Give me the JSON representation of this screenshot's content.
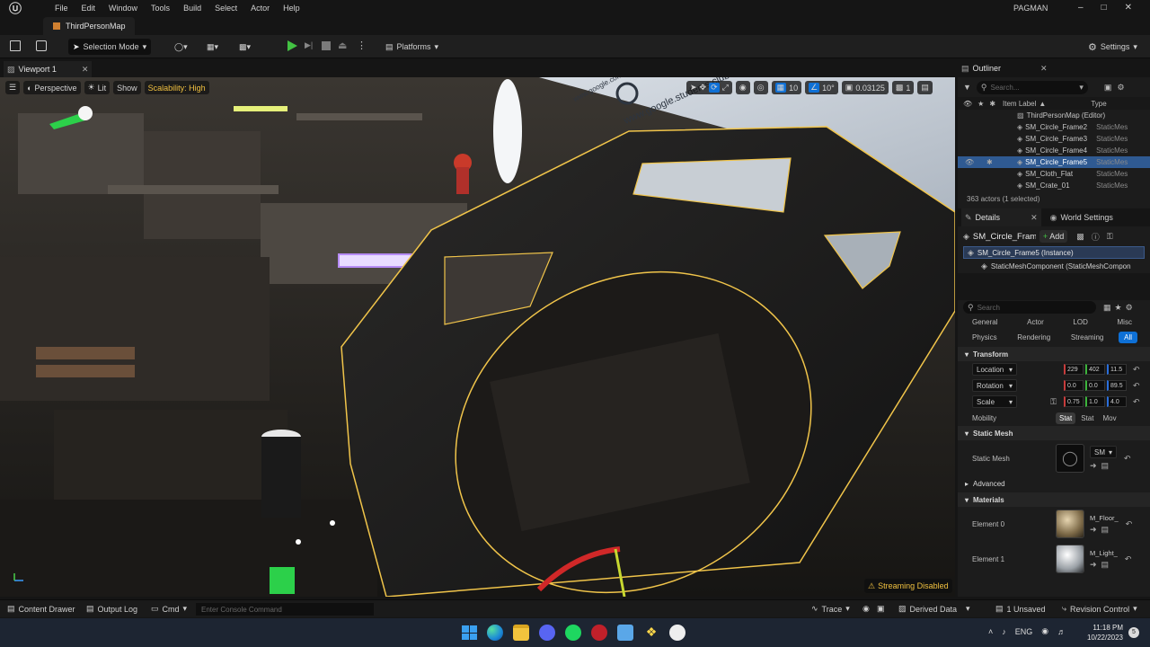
{
  "app": {
    "project_name": "PAGMAN",
    "map_tab": "ThirdPersonMap"
  },
  "menu": [
    "File",
    "Edit",
    "Window",
    "Tools",
    "Build",
    "Select",
    "Actor",
    "Help"
  ],
  "toolbar": {
    "selection_mode": "Selection Mode",
    "platforms": "Platforms",
    "settings": "Settings"
  },
  "viewport": {
    "tab": "Viewport 1",
    "perspective": "Perspective",
    "lit": "Lit",
    "show": "Show",
    "scalability": "Scalability: High",
    "grid_value": "10",
    "angle_value": "10°",
    "scale_value": "0.03125",
    "camera_speed": "1",
    "streaming_status": "Streaming Disabled",
    "sign_text_1": "www.google.students.club",
    "sign_text_2": "www.google.com"
  },
  "outliner": {
    "title": "Outliner",
    "search_placeholder": "Search...",
    "col_label": "Item Label",
    "col_type": "Type",
    "root": "ThirdPersonMap (Editor)",
    "items": [
      {
        "label": "SM_Circle_Frame2",
        "type": "StaticMes",
        "selected": false
      },
      {
        "label": "SM_Circle_Frame3",
        "type": "StaticMes",
        "selected": false
      },
      {
        "label": "SM_Circle_Frame4",
        "type": "StaticMes",
        "selected": false
      },
      {
        "label": "SM_Circle_Frame5",
        "type": "StaticMes",
        "selected": true
      },
      {
        "label": "SM_Cloth_Flat",
        "type": "StaticMes",
        "selected": false
      },
      {
        "label": "SM_Crate_01",
        "type": "StaticMes",
        "selected": false
      }
    ],
    "actor_count": "363 actors (1 selected)"
  },
  "details": {
    "title": "Details",
    "world_settings": "World Settings",
    "object_name": "SM_Circle_Fram",
    "add_label": "Add",
    "instance": "SM_Circle_Frame5 (Instance)",
    "component": "StaticMeshComponent (StaticMeshCompon",
    "search_placeholder": "Search",
    "filters_row1": [
      "General",
      "Actor",
      "LOD",
      "Misc"
    ],
    "filters_row2": [
      "Physics",
      "Rendering",
      "Streaming",
      "All"
    ],
    "transform_section": "Transform",
    "location_label": "Location",
    "location": [
      "229",
      "402",
      "11.5"
    ],
    "rotation_label": "Rotation",
    "rotation": [
      "0.0",
      "0.0",
      "89.5"
    ],
    "scale_label": "Scale",
    "scale": [
      "0.75",
      "1.0",
      "4.0"
    ],
    "mobility_label": "Mobility",
    "mobility_options": [
      "Stat",
      "Stat",
      "Mov"
    ],
    "static_mesh_section": "Static Mesh",
    "static_mesh_label": "Static Mesh",
    "static_mesh_value": "SM",
    "advanced_section": "Advanced",
    "materials_section": "Materials",
    "element0_label": "Element 0",
    "element0_value": "M_Floor_",
    "element1_label": "Element 1",
    "element1_value": "M_Light_"
  },
  "statusbar": {
    "content_drawer": "Content Drawer",
    "output_log": "Output Log",
    "cmd": "Cmd",
    "console_placeholder": "Enter Console Command",
    "trace": "Trace",
    "derived_data": "Derived Data",
    "unsaved": "1 Unsaved",
    "revision_control": "Revision Control"
  },
  "taskbar": {
    "lang": "ENG",
    "time": "11:18 PM",
    "date": "10/22/2023",
    "notif_count": "5"
  },
  "colors": {
    "accent": "#0e70d6",
    "selection_outline": "#f0c44a",
    "play_green": "#43c243"
  }
}
